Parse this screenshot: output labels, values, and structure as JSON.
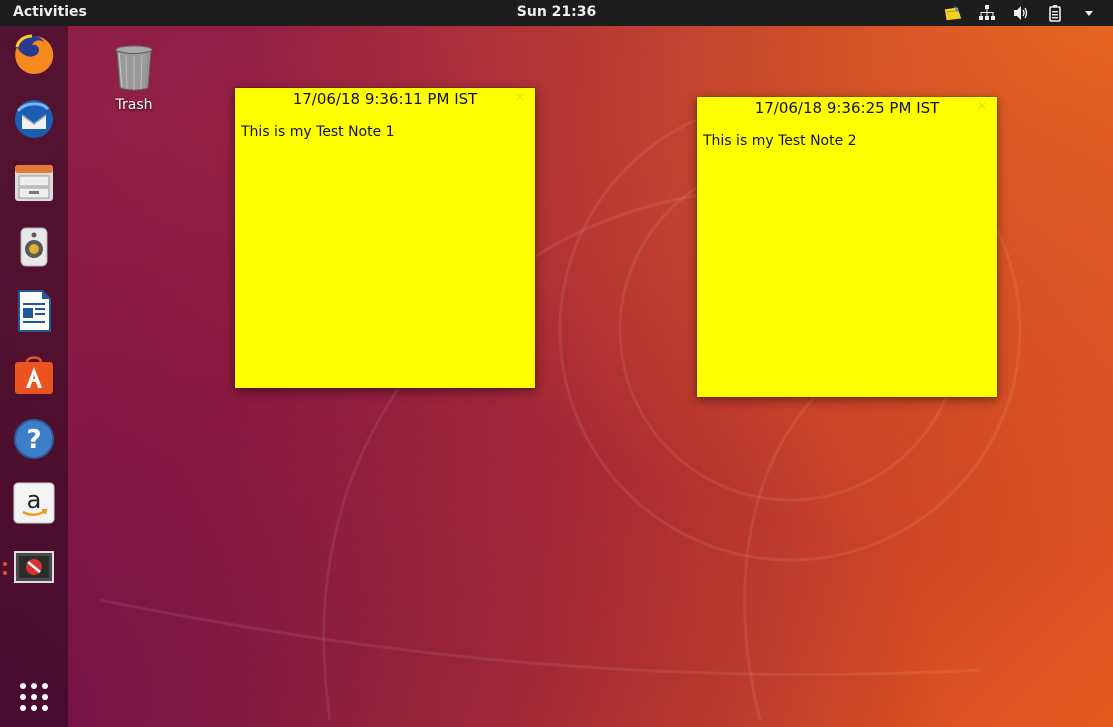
{
  "top_bar": {
    "activities_label": "Activities",
    "clock": "Sun 21:36",
    "tray": {
      "icons": [
        "indicator-stickynotes-icon",
        "network-icon",
        "volume-icon",
        "battery-icon",
        "menu-arrow-icon"
      ]
    }
  },
  "dock": {
    "items": [
      {
        "name": "firefox",
        "icon": "firefox-icon"
      },
      {
        "name": "thunderbird",
        "icon": "thunderbird-icon"
      },
      {
        "name": "files",
        "icon": "files-icon"
      },
      {
        "name": "rhythmbox",
        "icon": "rhythmbox-icon"
      },
      {
        "name": "libreoffice-writer",
        "icon": "writer-icon"
      },
      {
        "name": "ubuntu-software",
        "icon": "software-icon"
      },
      {
        "name": "help",
        "icon": "help-icon"
      },
      {
        "name": "amazon",
        "icon": "amazon-icon"
      },
      {
        "name": "indicator-stickynotes",
        "icon": "stickynotes-app-icon",
        "running": true
      }
    ],
    "show_apps_icon": "grid-icon"
  },
  "desktop": {
    "icons": [
      {
        "label": "Trash",
        "icon": "trash-icon"
      }
    ]
  },
  "notes": [
    {
      "timestamp": "17/06/18 9:36:11 PM IST",
      "body": "This is my Test Note 1"
    },
    {
      "timestamp": "17/06/18 9:36:25 PM IST",
      "body": "This is my Test Note 2"
    }
  ],
  "colors": {
    "note_bg": "#ffff00",
    "accent": "#e95420",
    "panel_bg": "#1d1d1d"
  }
}
